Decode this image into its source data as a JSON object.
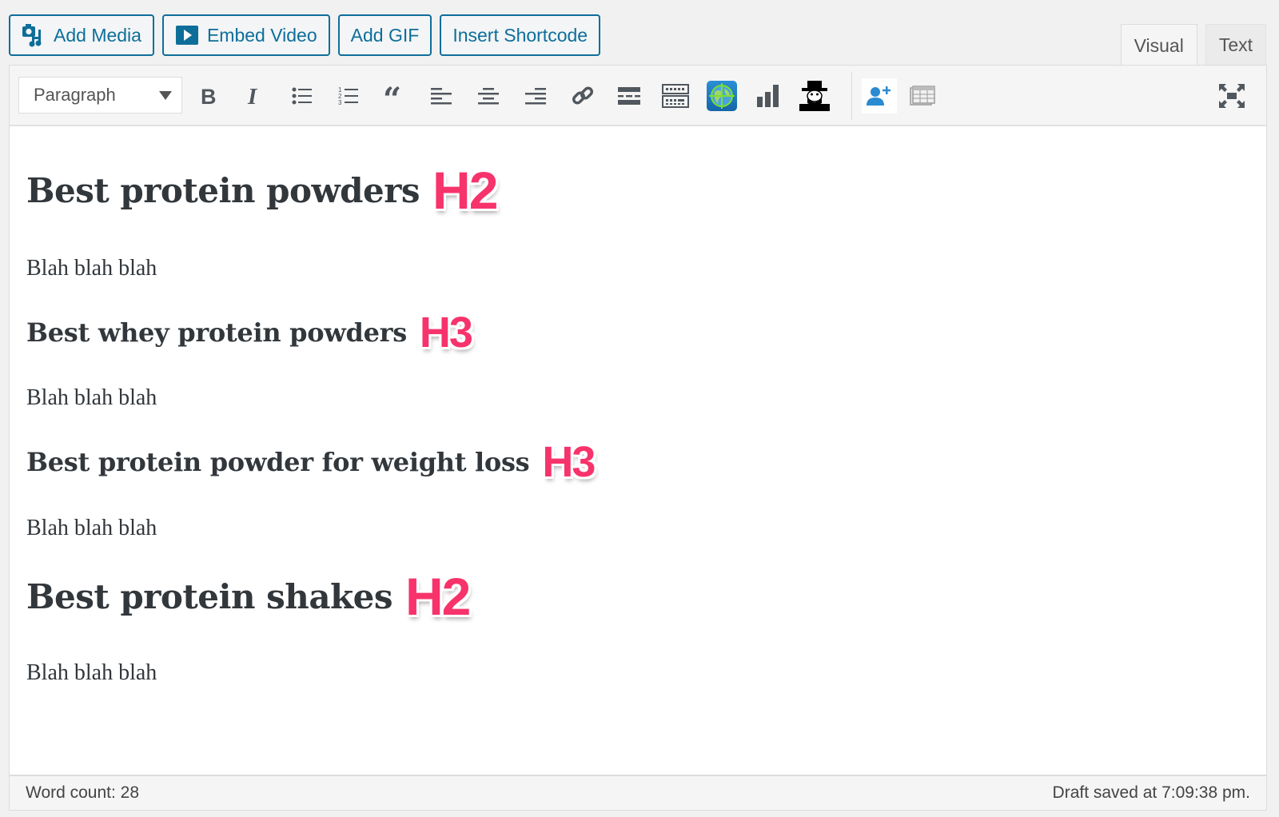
{
  "media_buttons": {
    "add_media": {
      "label": "Add Media",
      "icon": "media-icon"
    },
    "embed_video": {
      "label": "Embed Video",
      "icon": "play-icon"
    },
    "add_gif": {
      "label": "Add GIF"
    },
    "insert_shortcode": {
      "label": "Insert Shortcode"
    }
  },
  "tabs": {
    "visual": "Visual",
    "text": "Text",
    "active": "Visual"
  },
  "toolbar": {
    "format_select": "Paragraph",
    "tools": [
      "bold-icon",
      "italic-icon",
      "bullet-list-icon",
      "numbered-list-icon",
      "blockquote-icon",
      "align-left-icon",
      "align-center-icon",
      "align-right-icon",
      "link-icon",
      "read-more-icon",
      "toolbar-toggle-icon",
      "globe-target-icon",
      "bar-chart-icon",
      "detective-icon",
      "add-user-icon",
      "table-icon",
      "fullscreen-icon"
    ]
  },
  "content": {
    "blocks": [
      {
        "type": "h2",
        "text": "Best protein powders",
        "badge": "H2"
      },
      {
        "type": "p",
        "text": "Blah blah blah"
      },
      {
        "type": "h3",
        "text": "Best whey protein powders",
        "badge": "H3"
      },
      {
        "type": "p",
        "text": "Blah blah blah"
      },
      {
        "type": "h3",
        "text": "Best protein powder for weight loss",
        "badge": "H3"
      },
      {
        "type": "p",
        "text": "Blah blah blah"
      },
      {
        "type": "h2",
        "text": "Best protein shakes",
        "badge": "H2"
      },
      {
        "type": "p",
        "text": "Blah blah blah"
      }
    ]
  },
  "status": {
    "word_count": "Word count: 28",
    "draft_saved": "Draft saved at 7:09:38 pm."
  },
  "colors": {
    "accent": "#0e6e9a",
    "badge": "#f7336b",
    "icon": "#50575e"
  }
}
